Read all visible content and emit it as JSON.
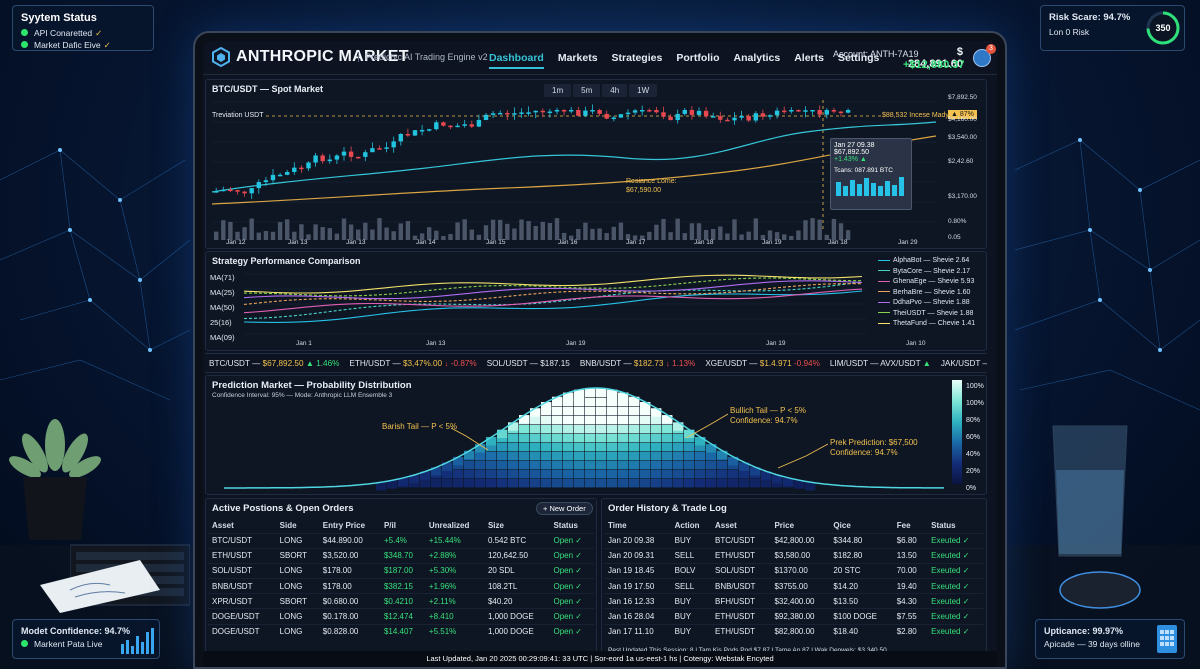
{
  "system_status": {
    "title": "Syytem Status",
    "items": [
      "API Conaretted",
      "Market Dafic Eive"
    ]
  },
  "risk": {
    "label": "Risk Scare: 94.7%",
    "sub": "Lon 0 Risk",
    "score": "350"
  },
  "confidence": {
    "label": "Modet Confidence: 94.7%",
    "sub": "Markent Pata Live"
  },
  "uptime": {
    "label": "Upticance: 99.97%",
    "sub": "Apicade — 39 days olline"
  },
  "nav": {
    "brand": "ANTHROPIC MARKET",
    "tagline": "Predictvc AI Trading Engine v2",
    "menu": [
      "Dashboard",
      "Markets",
      "Strategies",
      "Portfolio",
      "Analytics",
      "Alerts",
      "Settings"
    ],
    "active": "Dashboard",
    "account": "Account: ANTH-7A19",
    "balance": "$ 284,891.60",
    "pnl": "+$12,880.37",
    "notifications": "3"
  },
  "price_chart": {
    "title": "BTC/USDT — Spot Market",
    "timeframes": [
      "1m",
      "5m",
      "4h",
      "1W"
    ],
    "deviation_label": "Treviation USDT",
    "target_label": "$88,532 Incese Mady",
    "target_badge": "▲ 87%",
    "resistance_label": "Resiance Lome:",
    "resistance_value": "$67,590.00",
    "y_ticks": [
      "$7,892.50",
      "$4,160.00",
      "$3,540.00",
      "$2,42.60",
      "$3,170.00",
      "0.80%",
      "0.05"
    ],
    "x_ticks": [
      "Jan 12",
      "Jan 13",
      "Jan 13",
      "Jan 14",
      "Jan 15",
      "Jan 16",
      "Jan 17",
      "Jan 18",
      "Jan 19",
      "Jan 18",
      "Jan 29"
    ],
    "tooltip": {
      "date": "Jan 27 09.38",
      "price": "$67,892.50",
      "change": "+1.43% ▲",
      "volume": "Tcans: 087.891 BTC"
    }
  },
  "strategy_chart": {
    "title": "Strategy Performance Comparison",
    "y_labels": [
      "MA(71)",
      "MA(25)",
      "MA(50)",
      "25(16)",
      "MA(09)"
    ],
    "x_ticks": [
      "Jan 1",
      "Jan 13",
      "Jan 19",
      "Jan 19",
      "Jan 10"
    ],
    "legend": [
      {
        "name": "AlphaBot",
        "sharpe": "Shevie 2.64",
        "color": "#27c2e8"
      },
      {
        "name": "BytaCore",
        "sharpe": "Shevie 2.17",
        "color": "#46d6c8"
      },
      {
        "name": "GhenaEge",
        "sharpe": "Shevie 5.93",
        "color": "#e05fb5"
      },
      {
        "name": "BerhaBre",
        "sharpe": "Shevie 1.60",
        "color": "#f0a35a"
      },
      {
        "name": "DdhaPvo",
        "sharpe": "Shevie 1.88",
        "color": "#b06cf0"
      },
      {
        "name": "TheiUSDT",
        "sharpe": "Shevie 1.88",
        "color": "#8bd24c"
      },
      {
        "name": "ThetaFund",
        "sharpe": "Chevie 1.41",
        "color": "#f2e26a"
      }
    ]
  },
  "ticker": [
    {
      "pair": "BTC/USDT —",
      "price": "$67,892.50",
      "chg": "▲ 1.46%",
      "dir": "up"
    },
    {
      "pair": "ETH/USDT —",
      "price": "$3,47%.00",
      "chg": "↓ -0.87%",
      "dir": "down"
    },
    {
      "pair": "SOL/USDT — $187.15",
      "price": "",
      "chg": "",
      "dir": "up"
    },
    {
      "pair": "BNB/USDT —",
      "price": "$182.73",
      "chg": "↓ 1.13%",
      "dir": "down"
    },
    {
      "pair": "XGE/USDT —",
      "price": "$1.4.971",
      "chg": "-0.94%",
      "dir": "down"
    },
    {
      "pair": "LIM/USDT — AVX/USDT",
      "price": "",
      "chg": "▲",
      "dir": "up"
    },
    {
      "pair": "JAK/USDT —",
      "price": "$7.44",
      "chg": "-0.91%",
      "dir": "down"
    }
  ],
  "prediction": {
    "title": "Prediction Market — Probability Distribution",
    "subtitle": "Confidence Interval: 95% — Mode: Anthropic LLM Ensemble 3",
    "bearish": "Barish Tail — P < 5%",
    "bullish_1": "Bullich Tail — P < 5%",
    "bullish_2": "Confidence: 94.7%",
    "peak_1": "Prek Prediction: $67,500",
    "peak_2": "Confidence: 94.7%",
    "scale": [
      "100%",
      "100%",
      "80%",
      "60%",
      "40%",
      "20%",
      "0%"
    ]
  },
  "positions": {
    "title": "Active Postions & Open Orders",
    "new_order": "+ New Order",
    "columns": [
      "Asset",
      "Side",
      "Entry Price",
      "P/il",
      "Unrealized",
      "Size",
      "Status"
    ],
    "rows": [
      [
        "BTC/USDT",
        "LONG",
        "$44.890.00",
        "+5.4%",
        "+15.44%",
        "0.542 BTC",
        "Open ✓"
      ],
      [
        "ETH/USDT",
        "SBORT",
        "$3,520.00",
        "$348.70",
        "+2.88%",
        "120,642.50",
        "Open ✓"
      ],
      [
        "SOL/USDT",
        "LONG",
        "$178.00",
        "$187.00",
        "+5.30%",
        "20 SDL",
        "Open ✓"
      ],
      [
        "BNB/USDT",
        "LONG",
        "$178.00",
        "$382.15",
        "+1.96%",
        "108.2TL",
        "Open ✓"
      ],
      [
        "XPR/USDT",
        "SBORT",
        "$0.680.00",
        "$0.4210",
        "+2.11%",
        "$40.20",
        "Open ✓"
      ],
      [
        "DOGE/USDT",
        "LONG",
        "$0.178.00",
        "$12.474",
        "+8.410",
        "1,000 DOGE",
        "Open ✓"
      ],
      [
        "DOGE/USDT",
        "LONG",
        "$0.828.00",
        "$14.407",
        "+5.51%",
        "1,000 DOGE",
        "Open ✓"
      ]
    ]
  },
  "history": {
    "title": "Order History & Trade Log",
    "columns": [
      "Time",
      "Action",
      "Asset",
      "Price",
      "Qice",
      "Fee",
      "Status"
    ],
    "rows": [
      [
        "Jan 20 09.38",
        "BUY",
        "BTC/USDT",
        "$42,800.00",
        "$344.80",
        "$6.80",
        "Exeuted ✓"
      ],
      [
        "Jan 20 09.31",
        "SELL",
        "ETH/USDT",
        "$3,580.00",
        "$182.80",
        "13.50",
        "Exeuted ✓"
      ],
      [
        "Jan 19 18.45",
        "BOLV",
        "SOL/USDT",
        "$1370.00",
        "20 STC",
        "70.00",
        "Exeuted ✓"
      ],
      [
        "Jan 19 17.50",
        "SELL",
        "BNB/USDT",
        "$3755.00",
        "$14.20",
        "19.40",
        "Exeuted ✓"
      ],
      [
        "Jan 16 12.33",
        "BUY",
        "BFH/USDT",
        "$32,400.00",
        "$13.50",
        "$4.30",
        "Exeuted ✓"
      ],
      [
        "Jan 16 28.04",
        "BUY",
        "ETH/USDT",
        "$92,380.00",
        "$100 DOGE",
        "$7.55",
        "Exeuted ✓"
      ],
      [
        "Jan 17 11.10",
        "BUY",
        "ETH/USDT",
        "$82,800.00",
        "$18.40",
        "$2.80",
        "Exeuted ✓"
      ]
    ],
    "footer": "Pest Updated This Session: 8 | Tam Kis Pods Pod $7.87 | Tame Ap.87 | Wak Denwels: $3,340.50"
  },
  "statusbar": "Last Updated, Jan 20 2025 00:29:09:41: 33 UTC | Sor-eord 1a us-eest-1 hs | Cotengy: Webstak Encyted"
}
